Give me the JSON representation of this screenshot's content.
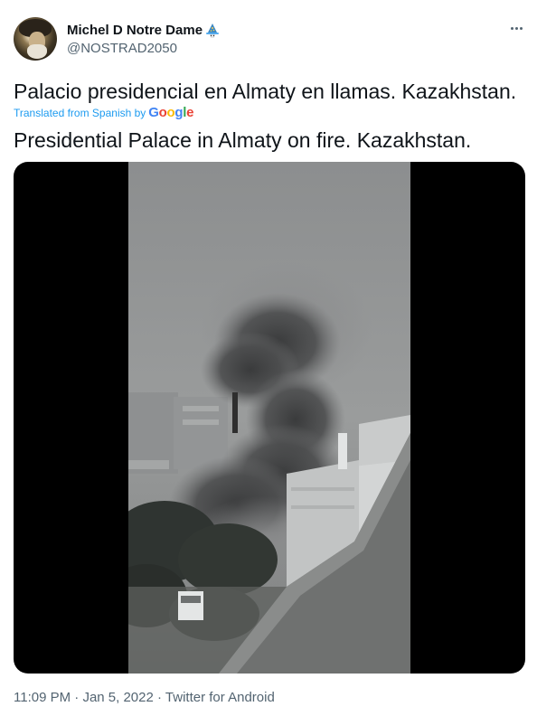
{
  "tweet": {
    "author": {
      "display_name": "Michel D Notre Dame",
      "handle": "@NOSTRAD2050",
      "badge_icon": "wizard-emoji-icon"
    },
    "text_original": "Palacio presidencial en Almaty en llamas. Kazakhstan.",
    "translation_note": "Translated from Spanish by",
    "translation_provider": "Google",
    "text_translated": "Presidential Palace in Almaty on fire. Kazakhstan.",
    "media": {
      "type": "video",
      "description_icon": "video-frame"
    },
    "footer": {
      "time": "11:09 PM",
      "separator": " · ",
      "date": "Jan 5, 2022",
      "source": "Twitter for Android"
    }
  },
  "colors": {
    "text": "#0f1419",
    "secondary": "#536471",
    "link": "#1d9bf0",
    "media_bg": "#000000"
  }
}
